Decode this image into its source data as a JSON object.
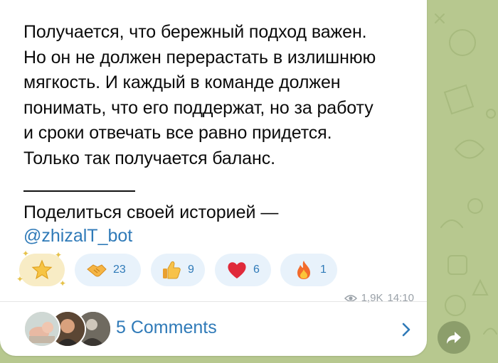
{
  "message": {
    "body": "Получается, что бережный подход важен.\nНо он не должен перерастать в излишнюю\nмягкость. И каждый в команде должен\nпонимать, что его поддержат, но за работу\nи сроки отвечать все равно придется.\nТолько так получается баланс.",
    "share_prompt": "Поделиться своей историей —",
    "bot_link": "@zhizalT_bot"
  },
  "reactions": [
    {
      "icon": "star-icon",
      "count": ""
    },
    {
      "icon": "handshake-icon",
      "count": "23"
    },
    {
      "icon": "thumbs-up-icon",
      "count": "9"
    },
    {
      "icon": "heart-icon",
      "count": "6"
    },
    {
      "icon": "fire-icon",
      "count": "1"
    }
  ],
  "meta": {
    "views": "1,9K",
    "time": "14:10",
    "views_icon": "eye-icon"
  },
  "comments": {
    "label": "5 Comments",
    "chevron_icon": "chevron-right-icon"
  },
  "share_button": {
    "icon": "share-forward-icon"
  },
  "colors": {
    "accent": "#2f7ab8",
    "reaction_bg": "#e8f2fb",
    "wallpaper": "#b7c88f",
    "meta": "#9aa1a8"
  }
}
